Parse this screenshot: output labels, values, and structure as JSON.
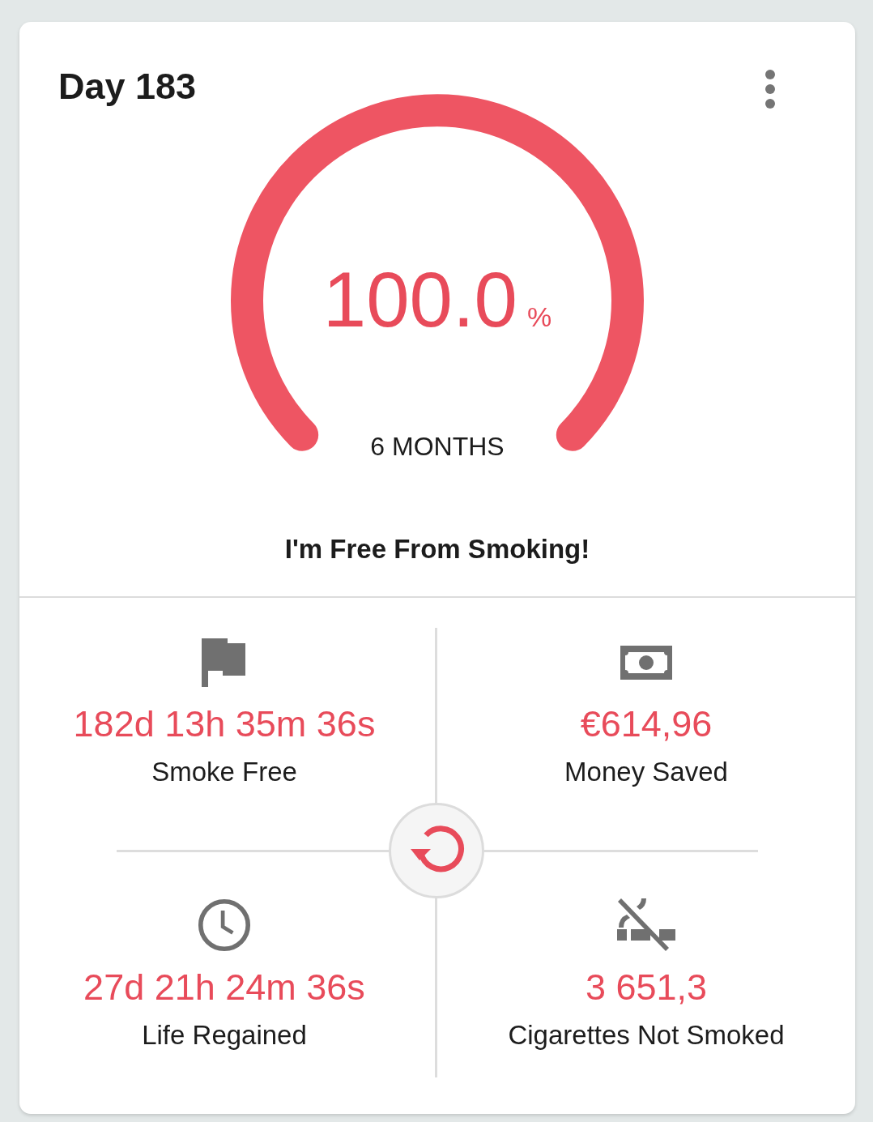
{
  "card": {
    "title": "Day 183"
  },
  "gauge": {
    "value": "100.0",
    "unit": "%",
    "caption": "6 MONTHS"
  },
  "status": "I'm Free From Smoking!",
  "stats": [
    {
      "kind": "flag",
      "value": "182d 13h 35m 36s",
      "label": "Smoke Free"
    },
    {
      "kind": "money",
      "value": "€614,96",
      "label": "Money Saved"
    },
    {
      "kind": "clock",
      "value": "27d 21h 24m 36s",
      "label": "Life Regained"
    },
    {
      "kind": "no-smoking",
      "value": "3 651,3",
      "label": "Cigarettes Not Smoked"
    }
  ]
}
